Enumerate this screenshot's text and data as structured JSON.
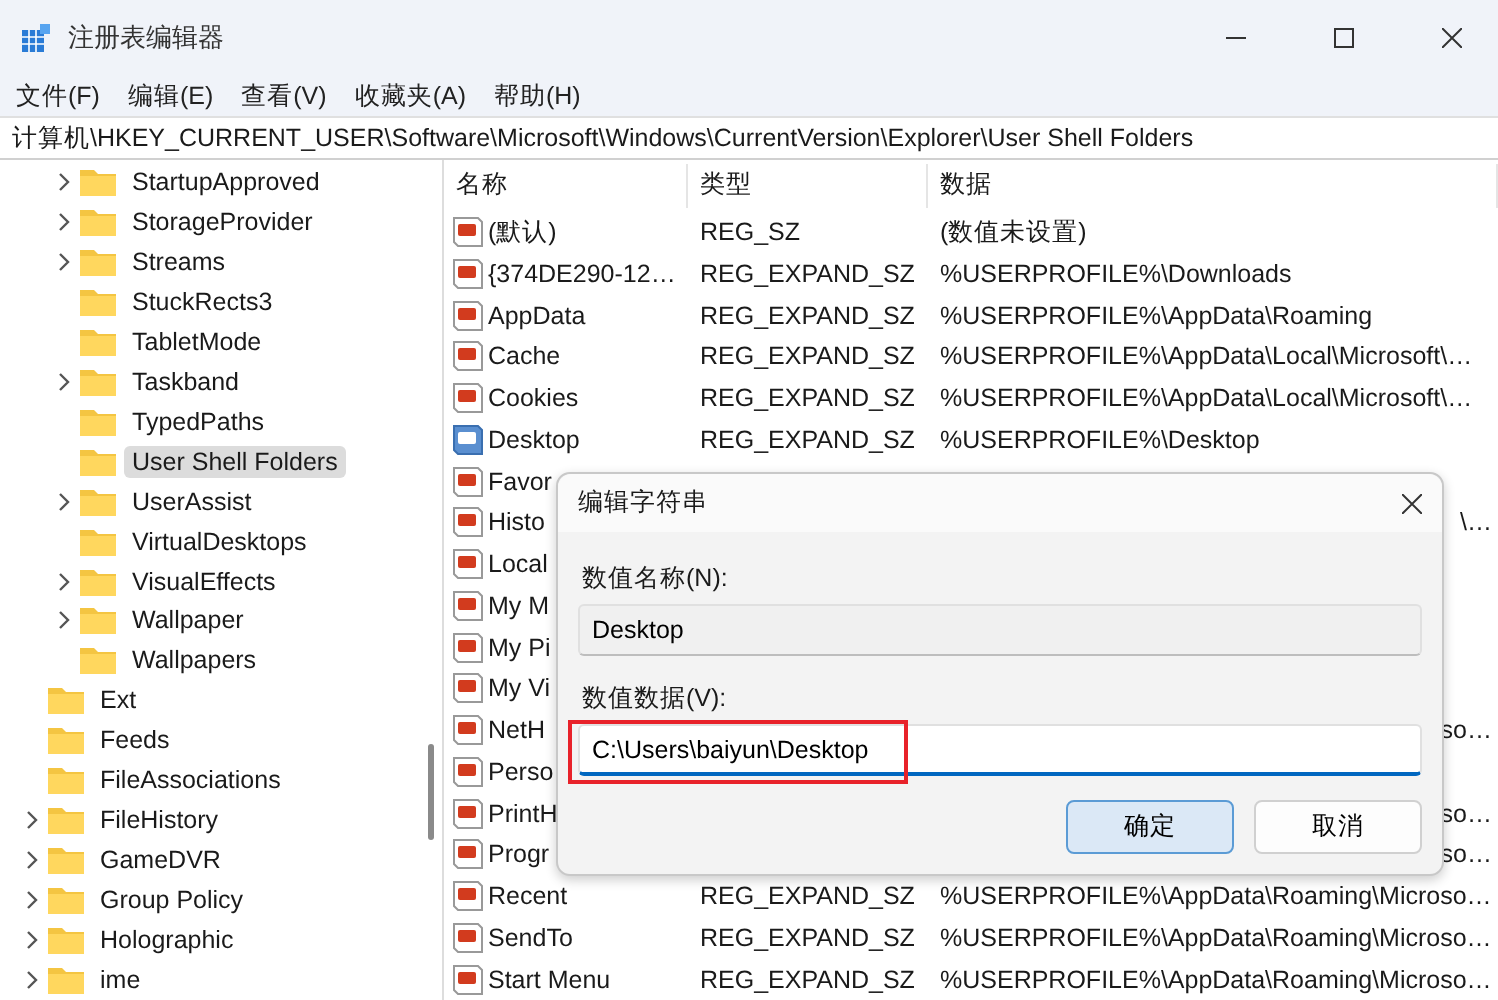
{
  "window": {
    "title": "注册表编辑器"
  },
  "menu": [
    "文件(F)",
    "编辑(E)",
    "查看(V)",
    "收藏夹(A)",
    "帮助(H)"
  ],
  "address": "计算机\\HKEY_CURRENT_USER\\Software\\Microsoft\\Windows\\CurrentVersion\\Explorer\\User Shell Folders",
  "tree": {
    "continued_children": [
      {
        "label": "StartupApproved",
        "expandable": true,
        "selected": false
      },
      {
        "label": "StorageProvider",
        "expandable": true,
        "selected": false
      },
      {
        "label": "Streams",
        "expandable": true,
        "selected": false
      },
      {
        "label": "StuckRects3",
        "expandable": false,
        "selected": false
      },
      {
        "label": "TabletMode",
        "expandable": false,
        "selected": false
      },
      {
        "label": "Taskband",
        "expandable": true,
        "selected": false
      },
      {
        "label": "TypedPaths",
        "expandable": false,
        "selected": false
      },
      {
        "label": "User Shell Folders",
        "expandable": false,
        "selected": true
      },
      {
        "label": "UserAssist",
        "expandable": true,
        "selected": false
      },
      {
        "label": "VirtualDesktops",
        "expandable": false,
        "selected": false
      },
      {
        "label": "VisualEffects",
        "expandable": true,
        "selected": false
      },
      {
        "label": "Wallpaper",
        "expandable": true,
        "selected": false
      },
      {
        "label": "Wallpapers",
        "expandable": false,
        "selected": false
      }
    ],
    "items": [
      {
        "label": "Ext",
        "expandable": false,
        "selected": false
      },
      {
        "label": "Feeds",
        "expandable": false,
        "selected": false
      },
      {
        "label": "FileAssociations",
        "expandable": false,
        "selected": false
      },
      {
        "label": "FileHistory",
        "expandable": true,
        "selected": false
      },
      {
        "label": "GameDVR",
        "expandable": true,
        "selected": false
      },
      {
        "label": "Group Policy",
        "expandable": true,
        "selected": false
      },
      {
        "label": "Holographic",
        "expandable": true,
        "selected": false
      },
      {
        "label": "ime",
        "expandable": true,
        "selected": false
      }
    ]
  },
  "table": {
    "columns": [
      "名称",
      "类型",
      "数据"
    ],
    "rows": [
      {
        "name": "(默认)",
        "type": "REG_SZ",
        "data": "(数值未设置)",
        "selected": false
      },
      {
        "name": "{374DE290-12…",
        "type": "REG_EXPAND_SZ",
        "data": "%USERPROFILE%\\Downloads",
        "selected": false
      },
      {
        "name": "AppData",
        "type": "REG_EXPAND_SZ",
        "data": "%USERPROFILE%\\AppData\\Roaming",
        "selected": false
      },
      {
        "name": "Cache",
        "type": "REG_EXPAND_SZ",
        "data": "%USERPROFILE%\\AppData\\Local\\Microsoft\\…",
        "selected": false
      },
      {
        "name": "Cookies",
        "type": "REG_EXPAND_SZ",
        "data": "%USERPROFILE%\\AppData\\Local\\Microsoft\\…",
        "selected": false
      },
      {
        "name": "Desktop",
        "type": "REG_EXPAND_SZ",
        "data": "%USERPROFILE%\\Desktop",
        "selected": true
      },
      {
        "name": "Favor",
        "selected": false
      },
      {
        "name": "Histo",
        "data": "\\…",
        "selected": false
      },
      {
        "name": "Local",
        "selected": false
      },
      {
        "name": "My M",
        "selected": false
      },
      {
        "name": "My Pi",
        "selected": false
      },
      {
        "name": "My Vi",
        "selected": false
      },
      {
        "name": "NetH",
        "data": "so…",
        "selected": false
      },
      {
        "name": "Perso",
        "selected": false
      },
      {
        "name": "PrintH",
        "data": "so…",
        "selected": false
      },
      {
        "name": "Progr",
        "data": "so…",
        "selected": false
      },
      {
        "name": "Recent",
        "type": "REG_EXPAND_SZ",
        "data": "%USERPROFILE%\\AppData\\Roaming\\Microso…",
        "selected": false
      },
      {
        "name": "SendTo",
        "type": "REG_EXPAND_SZ",
        "data": "%USERPROFILE%\\AppData\\Roaming\\Microso…",
        "selected": false
      },
      {
        "name": "Start Menu",
        "type": "REG_EXPAND_SZ",
        "data": "%USERPROFILE%\\AppData\\Roaming\\Microso…",
        "selected": false
      }
    ]
  },
  "dialog": {
    "title": "编辑字符串",
    "name_label": "数值名称(N):",
    "name_value": "Desktop",
    "data_label": "数值数据(V):",
    "data_value": "C:\\Users\\baiyun\\Desktop",
    "data_highlighted": true,
    "buttons": [
      {
        "label": "确定",
        "default": true
      },
      {
        "label": "取消",
        "default": false
      }
    ]
  }
}
